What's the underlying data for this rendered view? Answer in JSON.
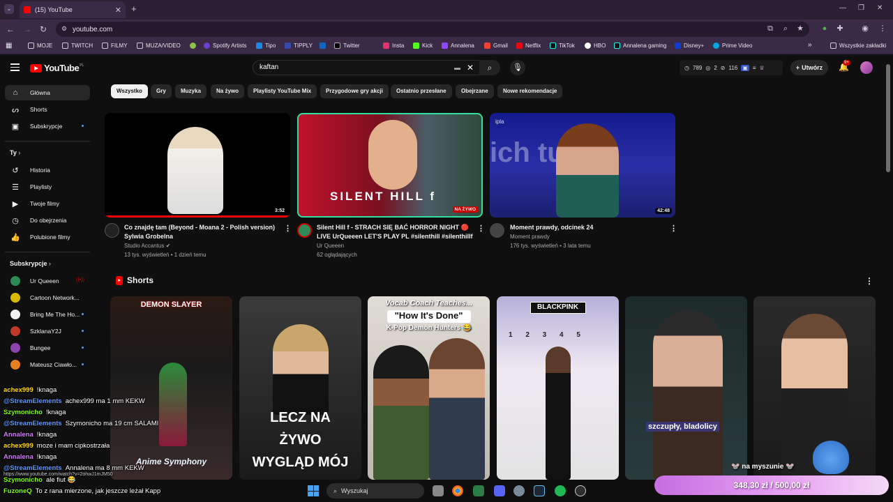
{
  "browser": {
    "tab_title": "(15) YouTube",
    "url": "youtube.com",
    "bookmarks": [
      "MOJE",
      "TWITCH",
      "FILMY",
      "MUZA/VIDEO",
      "Spotify Artists",
      "Tipo",
      "TIPPLY",
      "Twitter",
      "Insta",
      "Kick",
      "Annalena",
      "Gmail",
      "Netflix",
      "TikTok",
      "HBO",
      "Annalena gaming",
      "Disney+",
      "Prime Video"
    ],
    "other_bookmarks": "Wszystkie zakładki"
  },
  "youtube": {
    "logo_text": "YouTube",
    "region": "PL",
    "search_value": "kaftan",
    "stats": {
      "views": "789",
      "eye": "2",
      "live": "116"
    },
    "create_label": "Utwórz",
    "notif_count": "9+"
  },
  "sidebar": {
    "main": [
      {
        "label": "Główna",
        "icon": "home-icon",
        "active": true
      },
      {
        "label": "Shorts",
        "icon": "shorts-icon"
      },
      {
        "label": "Subskrypcje",
        "icon": "subscriptions-icon"
      }
    ],
    "you_header": "Ty",
    "you": [
      {
        "label": "Historia",
        "icon": "history-icon"
      },
      {
        "label": "Playlisty",
        "icon": "playlists-icon"
      },
      {
        "label": "Twoje filmy",
        "icon": "your-videos-icon"
      },
      {
        "label": "Do obejrzenia",
        "icon": "watch-later-icon"
      },
      {
        "label": "Polubione filmy",
        "icon": "liked-icon"
      }
    ],
    "subs_header": "Subskrypcje",
    "subs": [
      "Ur Queeen",
      "Cartoon Network...",
      "Bring Me The Ho...",
      "SzklanaY2J",
      "Bungee",
      "Mateusz Ciawło..."
    ],
    "subs_colors": [
      "#2e8b57",
      "#d9b800",
      "#f1f1f1",
      "#c0392b",
      "#8e44ad",
      "#e67e22"
    ]
  },
  "chips": [
    "Wszystko",
    "Gry",
    "Muzyka",
    "Na żywo",
    "Playlisty YouTube Mix",
    "Przygodowe gry akcji",
    "Ostatnio przesłane",
    "Obejrzane",
    "Nowe rekomendacje"
  ],
  "videos": [
    {
      "title": "Co znajdę tam (Beyond - Moana 2 - Polish version) Sylwia Grobelna",
      "channel": "Studio Accantus",
      "meta": "13 tys. wyświetleń • 1 dzień temu",
      "duration": "3:52"
    },
    {
      "title": "Silent Hill f - STRACH SIĘ BAĆ HORROR NIGHT 🔴 LIVE UrQueeen LET'S PLAY PL #silenthill #silenthillf",
      "channel": "Ur Queeen",
      "meta": "62 oglądających",
      "badge": "NA ŻYWO",
      "thumb_text": "SILENT HILL f"
    },
    {
      "title": "Moment prawdy, odcinek 24",
      "channel": "Moment prawdy",
      "meta": "176 tys. wyświetleń • 3 lata temu",
      "duration": "42:48",
      "thumb_text": "ipla"
    }
  ],
  "shorts": {
    "heading": "Shorts",
    "items": [
      {
        "top": "DEMON SLAYER",
        "bottom": "Anime Symphony"
      },
      {
        "bottom": "LECZ NA ŻYWO WYGLĄD MÓJ"
      },
      {
        "top": "Vocab Coach Teaches...",
        "mid": "\"How It's Done\"",
        "sub": "K-Pop Demon Hunters 😂"
      },
      {
        "top": "BLACKPINK",
        "counts": "1 2 3 4 5"
      },
      {
        "bottom": "szczupły, bladolicy"
      },
      {}
    ]
  },
  "chat": [
    {
      "user": "achex999",
      "msg": "!knaga",
      "color": "#ffd700"
    },
    {
      "user": "@StreamElements",
      "msg": "achex999 ma 1 mm KEKW",
      "color": "#5b9bff"
    },
    {
      "user": "Szymonicho",
      "msg": "!knaga",
      "color": "#7cfc00"
    },
    {
      "user": "@StreamElements",
      "msg": "Szymonicho ma 19 cm SALAMI",
      "color": "#5b9bff"
    },
    {
      "user": "Annalena",
      "msg": "!knaga",
      "color": "#d57bff"
    },
    {
      "user": "achex999",
      "msg": "moze i mam cipkostrzała",
      "color": "#ffd700"
    },
    {
      "user": "Annalena",
      "msg": "!knaga",
      "color": "#d57bff"
    },
    {
      "user": "@StreamElements",
      "msg": "Annalena ma 8 mm KEKW",
      "color": "#5b9bff"
    },
    {
      "user": "Szymonicho",
      "msg": "ale fiut 😂",
      "color": "#7cfc00"
    },
    {
      "user": "FuzoneQ",
      "msg": "To z rana mierzone, jak jeszcze leżał Kapp",
      "color": "#7cfc00"
    }
  ],
  "status_url": "https://www.youtube.com/watch?v=2ohwJ1mJM50",
  "overlay": {
    "donation": "348,30 zł / 500,00 zł",
    "mouse_label": "na myszunie"
  },
  "taskbar": {
    "search_placeholder": "Wyszukaj"
  }
}
